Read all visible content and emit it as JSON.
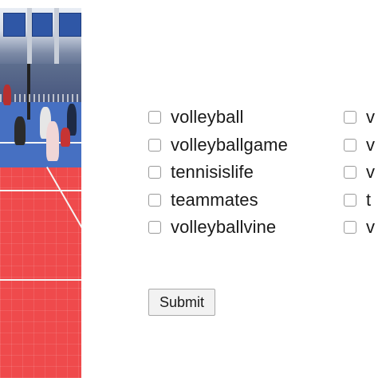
{
  "video": {
    "thumbnail_icon": "volleyball-court-video-frame"
  },
  "form": {
    "column_1": [
      {
        "label": "volleyball",
        "checked": false
      },
      {
        "label": "volleyballgame",
        "checked": false
      },
      {
        "label": "tennisislife",
        "checked": false
      },
      {
        "label": "teammates",
        "checked": false
      },
      {
        "label": "volleyballvine",
        "checked": false
      }
    ],
    "column_2": [
      {
        "label": "v",
        "checked": false
      },
      {
        "label": "v",
        "checked": false
      },
      {
        "label": "v",
        "checked": false
      },
      {
        "label": "t",
        "checked": false
      },
      {
        "label": "v",
        "checked": false
      }
    ],
    "submit_label": "Submit"
  },
  "colors": {
    "court_red": "#ef4a4c",
    "court_blue": "#4670c2",
    "button_bg": "#f2f2f2"
  }
}
